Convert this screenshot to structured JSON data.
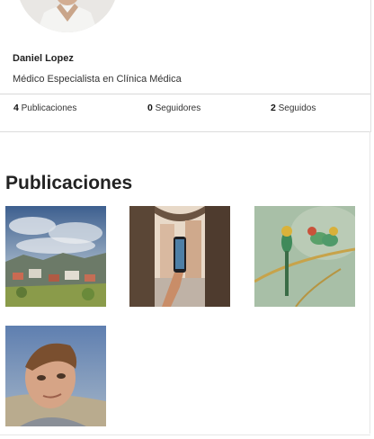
{
  "profile": {
    "name": "Daniel Lopez",
    "role": "Médico Especialista en Clínica Médica",
    "stats": [
      {
        "count": "4",
        "label": "Publicaciones"
      },
      {
        "count": "0",
        "label": "Seguidores"
      },
      {
        "count": "2",
        "label": "Seguidos"
      }
    ]
  },
  "posts_section": {
    "title": "Publicaciones",
    "posts": [
      {
        "subject": "village-landscape"
      },
      {
        "subject": "phone-photo-street"
      },
      {
        "subject": "bee-eater-birds"
      },
      {
        "subject": "child-portrait"
      }
    ]
  }
}
